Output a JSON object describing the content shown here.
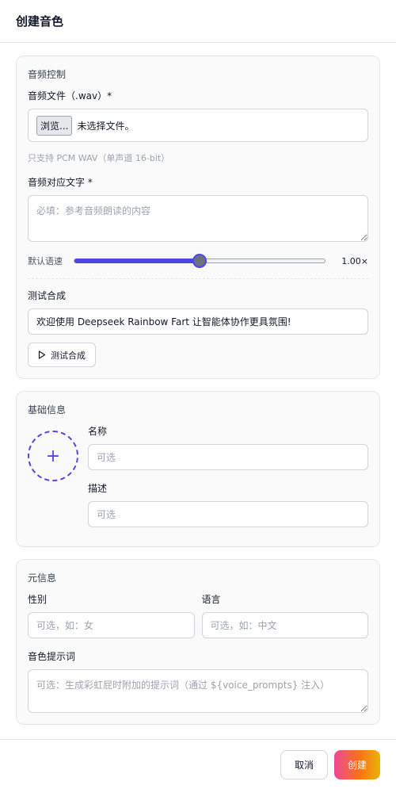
{
  "dialog": {
    "title": "创建音色"
  },
  "audio_section": {
    "title": "音频控制",
    "file_label": "音频文件（.wav）*",
    "file_button": "浏览...",
    "file_status": "未选择文件。",
    "file_hint": "只支持 PCM WAV（单声道 16-bit）",
    "text_label": "音频对应文字 *",
    "text_placeholder": "必填：参考音频朗读的内容",
    "speed_label": "默认语速",
    "speed_value": "1.00×",
    "speed_fraction": 0.5,
    "test_label": "测试合成",
    "test_text": "欢迎使用 Deepseek Rainbow Fart 让智能体协作更具氛围!",
    "test_button": "测试合成"
  },
  "basic_section": {
    "title": "基础信息",
    "avatar_icon": "plus-icon",
    "name_label": "名称",
    "name_placeholder": "可选",
    "desc_label": "描述",
    "desc_placeholder": "可选"
  },
  "meta_section": {
    "title": "元信息",
    "gender_label": "性别",
    "gender_placeholder": "可选，如：女",
    "language_label": "语言",
    "language_placeholder": "可选，如：中文",
    "prompt_label": "音色提示词",
    "prompt_placeholder": "可选：生成彩虹屁时附加的提示词（通过 ${voice_prompts} 注入）"
  },
  "footer": {
    "cancel_label": "取消",
    "create_label": "创建"
  },
  "colors": {
    "accent": "#4f46e5",
    "create_gradient": [
      "#ec4899",
      "#f97316",
      "#eab308"
    ]
  }
}
